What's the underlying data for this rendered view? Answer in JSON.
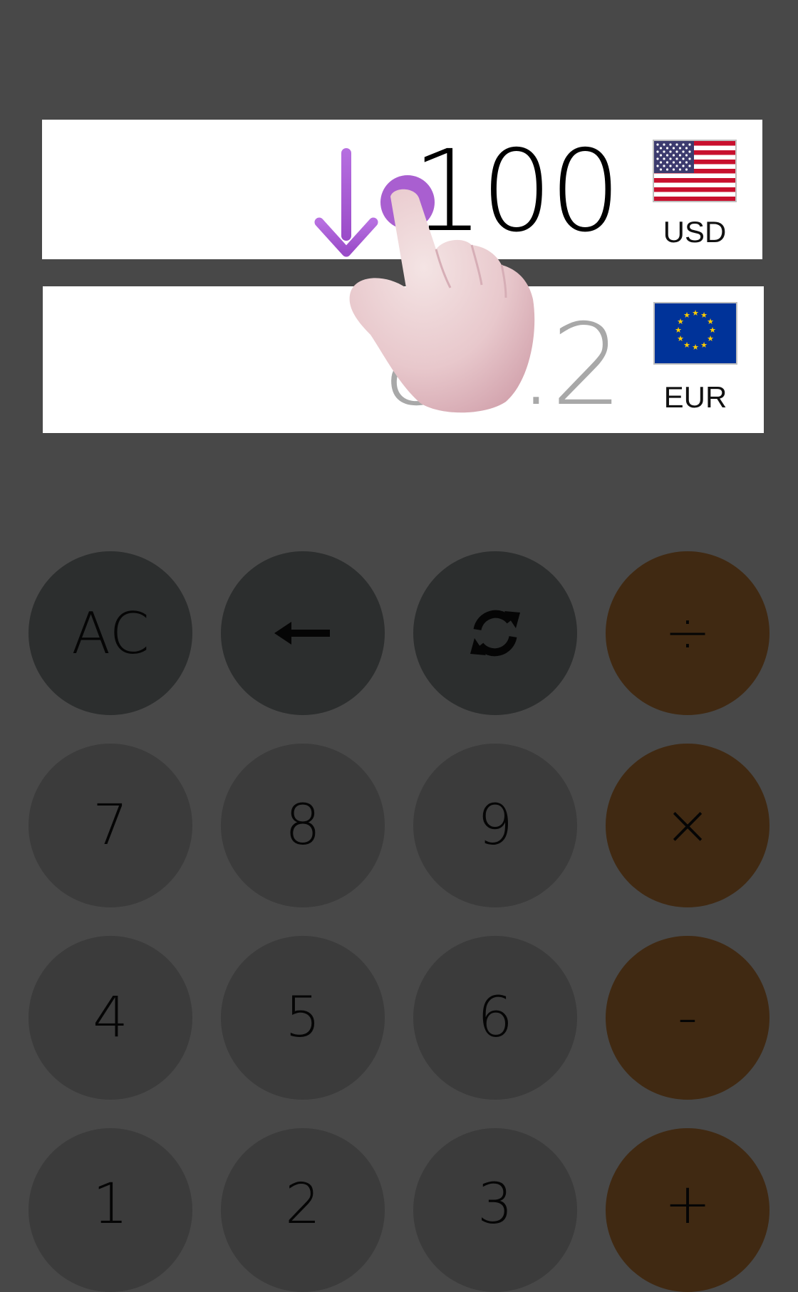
{
  "rows": [
    {
      "amount": "100",
      "code": "USD",
      "flag_icon": "us-flag-icon"
    },
    {
      "amount": "85.2",
      "code": "EUR",
      "flag_icon": "eu-flag-icon"
    }
  ],
  "keys": {
    "ac": "AC",
    "backspace_icon": "backspace-arrow-icon",
    "swap_icon": "swap-refresh-icon",
    "divide": "÷",
    "seven": "7",
    "eight": "8",
    "nine": "9",
    "multiply": "×",
    "four": "4",
    "five": "5",
    "six": "6",
    "minus": "-",
    "one": "1",
    "two": "2",
    "three": "3",
    "plus": "+"
  },
  "colors": {
    "background": "#484848",
    "function_key": "#2c2e2e",
    "number_key": "#3b3b3b",
    "operator_key": "#402912",
    "gesture_accent": "#a95fd0"
  },
  "gesture_hint": {
    "hand_icon": "tap-hand-icon",
    "arrow_icon": "swipe-down-arrow-icon"
  }
}
